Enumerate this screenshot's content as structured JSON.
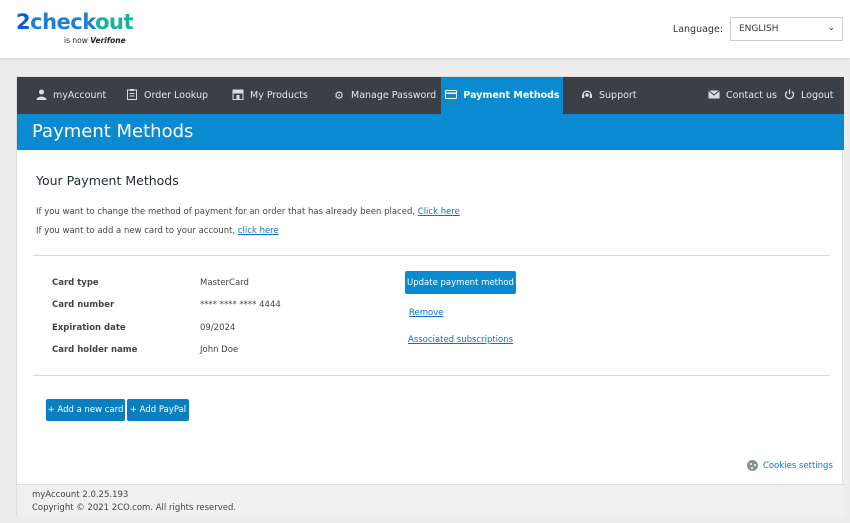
{
  "header": {
    "logo": {
      "part1": "2",
      "part2": "check",
      "part3": "out",
      "sub": "is now",
      "sub_brand": "Verifone"
    },
    "language_label": "Language:",
    "language_value": "ENGLISH"
  },
  "nav": {
    "items": [
      {
        "label": "myAccount",
        "icon": "user-icon"
      },
      {
        "label": "Order Lookup",
        "icon": "clipboard-icon"
      },
      {
        "label": "My Products",
        "icon": "store-icon"
      },
      {
        "label": "Manage Password",
        "icon": "gear-icon"
      },
      {
        "label": "Payment Methods",
        "icon": "credit-card-icon",
        "active": true
      },
      {
        "label": "Support",
        "icon": "support-icon"
      },
      {
        "label": "Contact us",
        "icon": "envelope-icon"
      },
      {
        "label": "Logout",
        "icon": "power-icon"
      }
    ]
  },
  "page": {
    "title": "Payment Methods",
    "section_title": "Your Payment Methods",
    "info1_text": "If you want to change the method of payment for an order that has already been placed, ",
    "info1_link": "Click here",
    "info2_text": "If you want to add a new card to your account, ",
    "info2_link": "click here"
  },
  "card": {
    "labels": {
      "type": "Card type",
      "number": "Card number",
      "expiration": "Expiration date",
      "holder": "Card holder name"
    },
    "values": {
      "type": "MasterCard",
      "number": "**** **** **** 4444",
      "expiration": "09/2024",
      "holder": "John Doe"
    },
    "actions": {
      "update": "Update payment method",
      "remove": "Remove",
      "subscriptions": "Associated subscriptions"
    }
  },
  "buttons": {
    "add_card": "+ Add a new card",
    "add_paypal": "+ Add PayPal"
  },
  "cookies_label": "Cookies settings",
  "footer": {
    "version": "myAccount 2.0.25.193",
    "copyright_prefix": "Copyright © 2021 ",
    "copyright_brand": "2CO.com",
    "copyright_suffix": ". All rights reserved."
  },
  "colors": {
    "accent": "#0a8bd1",
    "nav_bg": "#3a4046",
    "link": "#0a74c2"
  }
}
